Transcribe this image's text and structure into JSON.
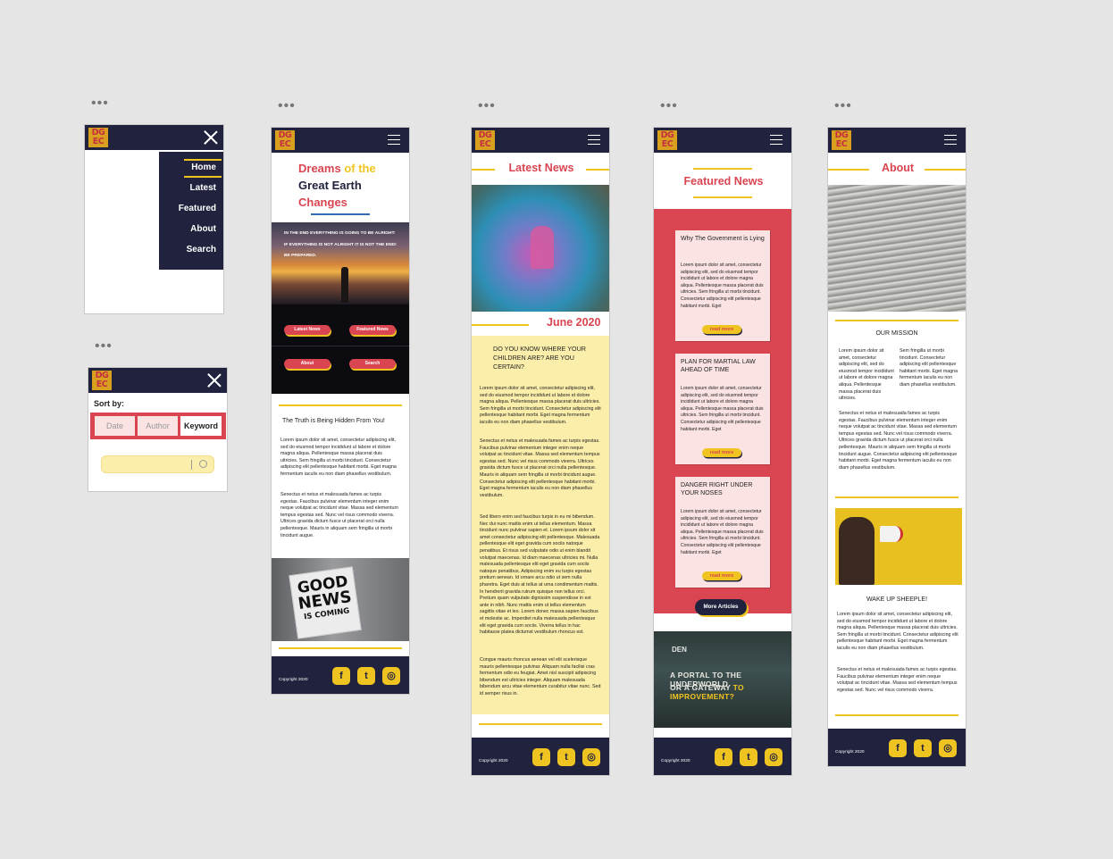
{
  "menu_screen": {
    "items": [
      "Home",
      "Latest",
      "Featured",
      "About",
      "Search"
    ]
  },
  "search_screen": {
    "sort_label": "Sort by:",
    "options": [
      "Date",
      "Author",
      "Keyword"
    ]
  },
  "home_screen": {
    "title": [
      "Dreams",
      "of the",
      "Great Earth",
      "Changes"
    ],
    "hero_lines": [
      "IN THE END EVERYTHING IS GOING TO BE ALRIGHT:",
      "IF EVERYTHING IS NOT ALRIGHT IT IS NOT THE END!",
      "BE PREPARED."
    ],
    "buttons": [
      "Latest News",
      "Featured News",
      "About",
      "Search"
    ],
    "article_title": "The Truth is Being Hidden From You!",
    "para1": "Lorem ipsum dolor sit amet, consectetur adipiscing elit, sed do eiusmod tempor incididunt ut labore et dolore magna aliqua. Pellentesque massa placerat duis ultricies. Sem fringilla ut morbi tincidunt. Consectetur adipiscing elit pellentesque habitant morbi. Eget magna fermentum iaculis eu non diam phasellus vestibulum.",
    "para2": "Senectus et netus et malesuada fames ac turpis egestas. Faucibus pulvinar elementum integer enim neque volutpat ac tincidunt vitae. Massa sed elementum tempus egestas sed. Nunc vel risus commodo viverra. Ultrices gravida dictum fusce ut placerat orci nulla pellentesque. Mauris in aliquam sem fringilla ut morbi tincidunt augue.",
    "sign_text": [
      "GOOD",
      "NEWS",
      "IS COMING"
    ],
    "copyright": "Copyright 2020"
  },
  "latest_screen": {
    "heading": "Latest News",
    "date": "June 2020",
    "question": "DO YOU KNOW WHERE YOUR CHILDREN ARE? ARE YOU CERTAIN?",
    "para1": "Lorem ipsum dolor sit amet, consectetur adipiscing elit, sed do eiusmod tempor incididunt ut labore et dolore magna aliqua. Pellentesque massa placerat duis ultricies. Sem fringilla ut morbi tincidunt. Consectetur adipiscing elit pellentesque habitant morbi. Eget magna fermentum iaculis eu non diam phasellus vestibulum.",
    "para2": "Senectus et netus et malesuada fames ac turpis egestas. Faucibus pulvinar elementum integer enim neque volutpat ac tincidunt vitae. Massa sed elementum tempus egestas sed. Nunc vel risus commodo viverra. Ultrices gravida dictum fusce ut placerat orci nulla pellentesque. Mauris in aliquam sem fringilla ut morbi tincidunt augue. Consectetur adipiscing elit pellentesque habitant morbi. Eget magna fermentum iaculis eu non diam phasellus vestibulum.",
    "para3": "Sed libero enim sed faucibus turpis in eu mi bibendum. Nec dui nunc mattis enim ut tellus elementum. Massa tincidunt nunc pulvinar sapien et. Lorem ipsum dolor sit amet consectetur adipiscing elit pellentesque. Malesuada pellentesque elit eget gravida cum sociis natoque penatibus. Et risus sed vulputate odio ut enim blandit volutpat maecenas. Id diam maecenas ultricies mi. Nulla malesuada pellentesque elit eget gravida cum sociis natoque penatibus. Adipiscing enim eu turpis egestas pretium aenean. Id ornare arcu odio ut sem nulla pharetra. Eget duis at tellus at urna condimentum mattis. In hendrerit gravida rutrum quisque non tellus orci. Pretium quam vulputate dignissim suspendisse in est ante in nibh. Nunc mattis enim ut tellus elementum sagittis vitae et leo. Lorem donec massa sapien faucibus et molestie ac. Imperdiet nulla malesuada pellentesque elit eget gravida cum sociis. Viverra tellus in hac habitasse platea dictumst vestibulum rhoncus est.",
    "para4": "Congue mauris rhoncus aenean vel elit scelerisque mauris pellentesque pulvinar. Aliquam nulla facilisi cras fermentum odio eu feugiat. Amet nisl suscipit adipiscing bibendum est ultricies integer. Aliquam malesuada bibendum arcu vitae elementum curabitur vitae nunc. Sed id semper risus in.",
    "copyright": "Copyright 2020"
  },
  "featured_screen": {
    "heading": "Featured News",
    "cards": [
      {
        "title": "Why The Government is Lying",
        "read_more": "read more"
      },
      {
        "title": "PLAN FOR MARTIAL LAW AHEAD OF TIME",
        "read_more": "read more"
      },
      {
        "title": "DANGER RIGHT UNDER YOUR NOSES",
        "read_more": "read more"
      }
    ],
    "card_body": "Lorem ipsum dolor sit amet, consectetur adipiscing elit, sed do eiusmod tempor incididunt ut labore et dolore magna aliqua. Pellentesque massa placerat duis ultricies. Sem fringilla ut morbi tincidunt. Consectetur adipiscing elit pellentesque habitant morbi. Eget",
    "more_button": "More Articles",
    "banner_small": "DEN",
    "banner_line1": "A PORTAL TO THE UNDERWORLD",
    "banner_line2_a": "OR A GATEWAY",
    "banner_line2_b": "TO IMPROVEMENT?",
    "copyright": "Copyright 2020"
  },
  "about_screen": {
    "heading": "About",
    "mission_title": "OUR MISSION",
    "col1": "Lorem ipsum dolor sit amet, consectetur adipiscing elit, sed do eiusmod tempor incididunt ut labore et dolore magna aliqua. Pellentesque massa placerat duis ultricies.",
    "col2": "Sem fringilla ut morbi tincidunt. Consectetur adipiscing elit pellentesque habitant morbi. Eget magna fermentum iaculis eu non diam phasellus vestibulum.",
    "para": "Senectus et netus et malesuada fames ac turpis egestas. Faucibus pulvinar elementum integer enim neque volutpat ac tincidunt vitae. Massa sed elementum tempus egestas sed. Nunc vel risus commodo viverra. Ultrices gravida dictum fusce ut placerat orci nulla pellentesque. Mauris in aliquam sem fringilla ut morbi tincidunt augue. Consectetur adipiscing elit pellentesque habitant morbi. Eget magna fermentum iaculis eu non diam phasellus vestibulum.",
    "wake_title": "WAKE UP SHEEPLE!",
    "wake_p1": "Lorem ipsum dolor sit amet, consectetur adipiscing elit, sed do eiusmod tempor incididunt ut labore et dolore magna aliqua. Pellentesque massa placerat duis ultricies. Sem fringilla ut morbi tincidunt. Consectetur adipiscing elit pellentesque habitant morbi. Eget magna fermentum iaculis eu non diam phasellus vestibulum.",
    "wake_p2": "Senectus et netus et malesuada fames ac turpis egestas. Faucibus pulvinar elementum integer enim neque volutpat ac tincidunt vitae. Massa sed elementum tempus egestas sed. Nunc vel risus commodo viverra.",
    "copyright": "Copyright 2020"
  },
  "logo": [
    "DG",
    "EC"
  ],
  "dots": "•••",
  "social": {
    "facebook": "f",
    "twitter": "t",
    "instagram": "◎"
  },
  "colors": {
    "navy": "#21233e",
    "red": "#d94550",
    "yellow": "#f0c420",
    "pale_yellow": "#fbeeaa",
    "pink": "#fbe3e4"
  }
}
